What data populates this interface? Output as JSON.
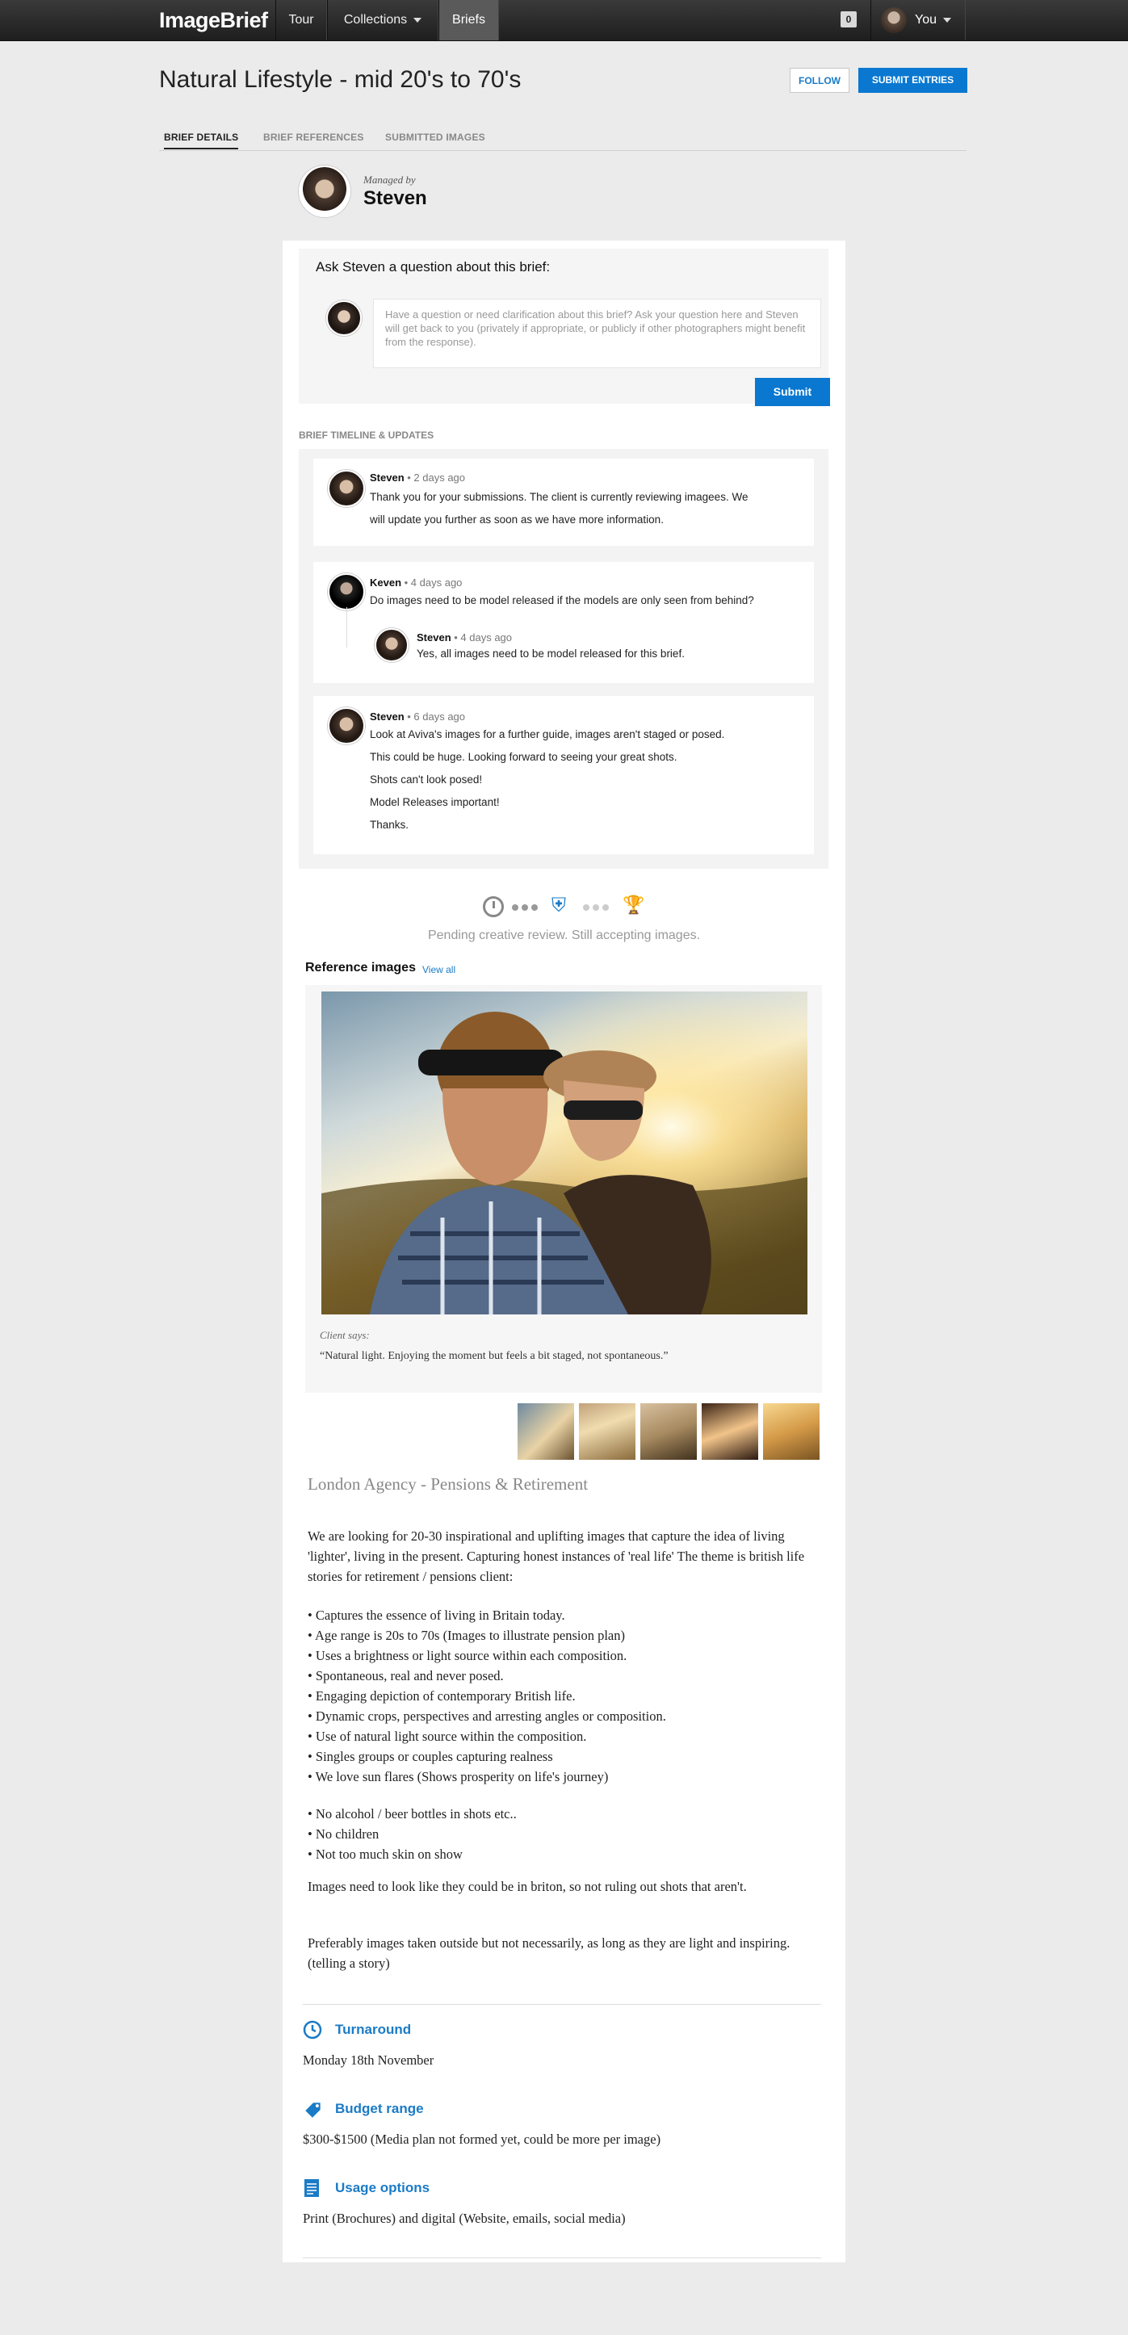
{
  "nav": {
    "logo": "ImageBrief",
    "items": [
      {
        "label": "Tour"
      },
      {
        "label": "Collections"
      },
      {
        "label": "Briefs"
      }
    ],
    "cart_count": "0",
    "user_label": "You"
  },
  "header": {
    "title": "Natural Lifestyle - mid 20's to 70's",
    "follow_label": "FOLLOW",
    "submit_label": "SUBMIT ENTRIES",
    "tabs": [
      "BRIEF DETAILS",
      "BRIEF REFERENCES",
      "SUBMITTED IMAGES"
    ]
  },
  "manager": {
    "managed_by": "Managed by",
    "name": "Steven"
  },
  "ask": {
    "title": "Ask Steven a question about this brief:",
    "placeholder": "Have a question or need clarification about this brief? Ask your question here and Steven will get back to you (privately if appropriate, or publicly if other photographers might benefit from the response).",
    "submit_label": "Submit"
  },
  "timeline": {
    "heading": "BRIEF TIMELINE & UPDATES",
    "posts": [
      {
        "author": "Steven",
        "time": " • 2 days ago",
        "lines": [
          "Thank you for your submissions. The client is currently reviewing imagees. We",
          "will update you further as soon as we have more information."
        ]
      },
      {
        "author": "Keven",
        "time": " • 4 days ago",
        "lines": [
          "Do images need to be model released if the models are only seen from behind?"
        ],
        "reply": {
          "author": "Steven",
          "time": " • 4 days ago",
          "text": "Yes, all images need to be model released for this brief."
        }
      },
      {
        "author": "Steven",
        "time": " • 6 days ago",
        "lines": [
          "Look at Aviva's images for a further guide, images aren't staged or posed.",
          "This could be huge. Looking forward to seeing your great shots.",
          "Shots can't look posed!",
          "Model Releases important!",
          "Thanks."
        ]
      }
    ]
  },
  "status": {
    "text": "Pending creative review. Still accepting images.",
    "icons": [
      "clock-icon",
      "review-icon",
      "trophy-icon"
    ],
    "active_color": "#1a7bc6"
  },
  "references": {
    "heading": "Reference images",
    "view_all": "View all",
    "client_says": "Client says:",
    "quote": "“Natural light. Enjoying the moment but feels a bit staged, not spontaneous.”"
  },
  "brief": {
    "title": "London Agency - Pensions & Retirement",
    "intro": "We are looking for 20-30 inspirational and uplifting images that capture the idea of living 'lighter', living in the present. Capturing honest instances of 'real life' The theme is british life stories for retirement / pensions client:",
    "bullets": [
      "Captures the essence of living in Britain today.",
      "Age range is 20s to 70s (Images to illustrate pension plan)",
      "Uses a brightness or light source within each composition.",
      "Spontaneous, real and never posed.",
      "Engaging depiction of contemporary British life.",
      "Dynamic crops, perspectives and arresting angles or composition.",
      "Use of natural light source within the composition.",
      "Singles groups or couples capturing realness",
      "We love sun flares (Shows prosperity on life's journey)"
    ],
    "restrictions": [
      "No alcohol / beer bottles in shots etc..",
      "No children",
      "Not too much skin on show"
    ],
    "para1": "Images need to look like they could be in briton, so not ruling out shots that aren't.",
    "para2": "Preferably images taken outside but not necessarily, as long as they are light and inspiring. (telling a story)"
  },
  "meta": {
    "turnaround_label": "Turnaround",
    "turnaround_value": "Monday 18th November",
    "budget_label": "Budget range",
    "budget_value": "$300-$1500 (Media plan not formed yet, could be more per image)",
    "usage_label": "Usage options",
    "usage_value": "Print (Brochures) and digital (Website, emails, social media)"
  },
  "colors": {
    "accent": "#0a78d0",
    "nav_bg": "#2a2a2a",
    "page_bg": "#ebebeb"
  }
}
